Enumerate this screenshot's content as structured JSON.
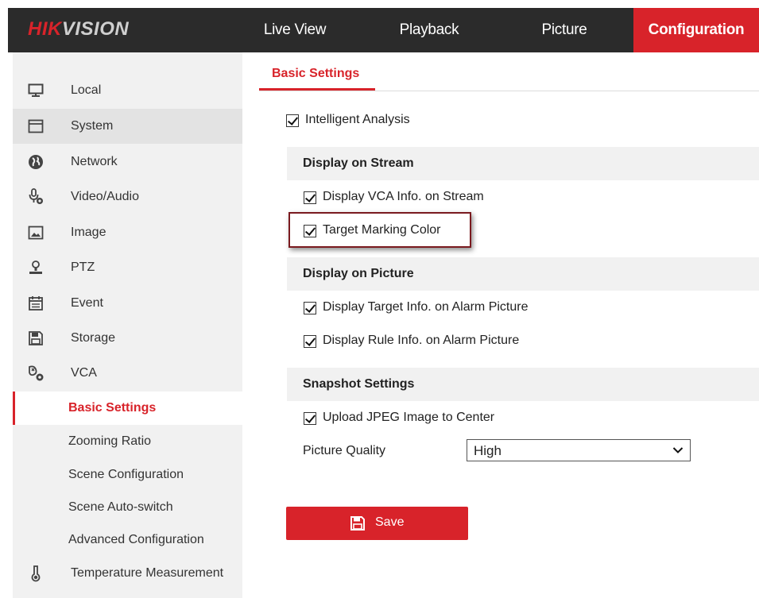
{
  "brand": {
    "logo_red": "HIK",
    "logo_white": "VISION"
  },
  "nav": {
    "items": [
      {
        "label": "Live View"
      },
      {
        "label": "Playback"
      },
      {
        "label": "Picture"
      },
      {
        "label": "Configuration",
        "active": true
      }
    ]
  },
  "sidebar": {
    "items": [
      {
        "label": "Local",
        "icon": "monitor-icon"
      },
      {
        "label": "System",
        "icon": "window-icon",
        "selected": true
      },
      {
        "label": "Network",
        "icon": "globe-icon"
      },
      {
        "label": "Video/Audio",
        "icon": "microphone-icon"
      },
      {
        "label": "Image",
        "icon": "image-icon"
      },
      {
        "label": "PTZ",
        "icon": "ptz-icon"
      },
      {
        "label": "Event",
        "icon": "calendar-icon"
      },
      {
        "label": "Storage",
        "icon": "floppy-icon"
      },
      {
        "label": "VCA",
        "icon": "vca-icon"
      }
    ],
    "vca_sub": [
      {
        "label": "Basic Settings",
        "active": true
      },
      {
        "label": "Zooming Ratio"
      },
      {
        "label": "Scene Configuration"
      },
      {
        "label": "Scene Auto-switch"
      },
      {
        "label": "Advanced Configuration"
      }
    ],
    "last_item": {
      "label": "Temperature Measurement",
      "icon": "thermometer-icon"
    }
  },
  "main": {
    "tab_label": "Basic Settings",
    "intelligent_analysis": {
      "label": "Intelligent Analysis",
      "checked": true
    },
    "sections": {
      "stream": "Display on Stream",
      "picture": "Display on Picture",
      "snapshot": "Snapshot Settings"
    },
    "stream_options": [
      {
        "label": "Display VCA Info. on Stream",
        "checked": true
      },
      {
        "label": "Target Marking Color",
        "checked": true
      }
    ],
    "picture_options": [
      {
        "label": "Display Target Info. on Alarm Picture",
        "checked": true
      },
      {
        "label": "Display Rule Info. on Alarm Picture",
        "checked": true
      }
    ],
    "snapshot_options": [
      {
        "label": "Upload JPEG Image to Center",
        "checked": true
      }
    ],
    "picture_quality": {
      "label": "Picture Quality",
      "value": "High"
    },
    "save_label": "Save"
  },
  "colors": {
    "accent": "#d8232a",
    "topbar": "#2b2b2b",
    "sidebar": "#f1f1f1",
    "highlight": "#7a1a1f"
  }
}
